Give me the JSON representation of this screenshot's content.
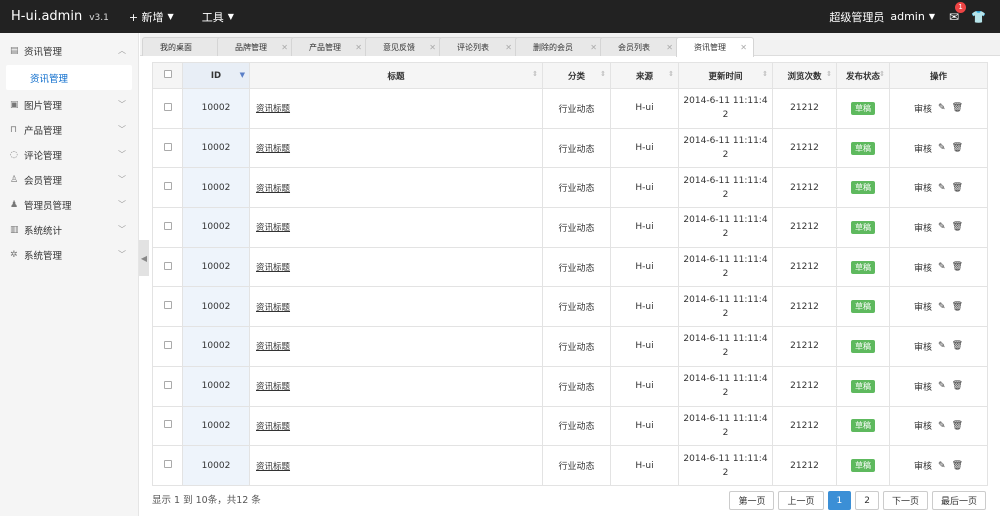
{
  "app": {
    "brand": "H-ui.admin",
    "version": "v3.1"
  },
  "topnav": [
    {
      "label": "+ 新增"
    },
    {
      "label": "工具"
    }
  ],
  "user": {
    "role": "超级管理员",
    "name": "admin",
    "mail_badge": "1"
  },
  "sidebar": {
    "items": [
      {
        "label": "资讯管理",
        "icon": "document-icon"
      },
      {
        "label": "图片管理",
        "icon": "image-icon"
      },
      {
        "label": "产品管理",
        "icon": "bag-icon"
      },
      {
        "label": "评论管理",
        "icon": "comment-icon"
      },
      {
        "label": "会员管理",
        "icon": "user-icon"
      },
      {
        "label": "管理员管理",
        "icon": "admin-icon"
      },
      {
        "label": "系统统计",
        "icon": "stats-icon"
      },
      {
        "label": "系统管理",
        "icon": "gear-icon"
      }
    ],
    "active_sub": "资讯管理"
  },
  "tabs": [
    {
      "label": "我的桌面"
    },
    {
      "label": "品牌管理"
    },
    {
      "label": "产品管理"
    },
    {
      "label": "意见反馈"
    },
    {
      "label": "评论列表"
    },
    {
      "label": "删除的会员"
    },
    {
      "label": "会员列表"
    },
    {
      "label": "资讯管理"
    }
  ],
  "table": {
    "headers": {
      "id": "ID",
      "title": "标题",
      "category": "分类",
      "source": "来源",
      "updated": "更新时间",
      "views": "浏览次数",
      "status": "发布状态",
      "actions": "操作"
    },
    "rows": [
      {
        "id": "10002",
        "title": "资讯标题",
        "category": "行业动态",
        "source": "H-ui",
        "time1": "2014-6-11 11:11:4",
        "time2": "2",
        "views": "21212",
        "status": "草稿",
        "op": "审核"
      },
      {
        "id": "10002",
        "title": "资讯标题",
        "category": "行业动态",
        "source": "H-ui",
        "time1": "2014-6-11 11:11:4",
        "time2": "2",
        "views": "21212",
        "status": "草稿",
        "op": "审核"
      },
      {
        "id": "10002",
        "title": "资讯标题",
        "category": "行业动态",
        "source": "H-ui",
        "time1": "2014-6-11 11:11:4",
        "time2": "2",
        "views": "21212",
        "status": "草稿",
        "op": "审核"
      },
      {
        "id": "10002",
        "title": "资讯标题",
        "category": "行业动态",
        "source": "H-ui",
        "time1": "2014-6-11 11:11:4",
        "time2": "2",
        "views": "21212",
        "status": "草稿",
        "op": "审核"
      },
      {
        "id": "10002",
        "title": "资讯标题",
        "category": "行业动态",
        "source": "H-ui",
        "time1": "2014-6-11 11:11:4",
        "time2": "2",
        "views": "21212",
        "status": "草稿",
        "op": "审核"
      },
      {
        "id": "10002",
        "title": "资讯标题",
        "category": "行业动态",
        "source": "H-ui",
        "time1": "2014-6-11 11:11:4",
        "time2": "2",
        "views": "21212",
        "status": "草稿",
        "op": "审核"
      },
      {
        "id": "10002",
        "title": "资讯标题",
        "category": "行业动态",
        "source": "H-ui",
        "time1": "2014-6-11 11:11:4",
        "time2": "2",
        "views": "21212",
        "status": "草稿",
        "op": "审核"
      },
      {
        "id": "10002",
        "title": "资讯标题",
        "category": "行业动态",
        "source": "H-ui",
        "time1": "2014-6-11 11:11:4",
        "time2": "2",
        "views": "21212",
        "status": "草稿",
        "op": "审核"
      },
      {
        "id": "10002",
        "title": "资讯标题",
        "category": "行业动态",
        "source": "H-ui",
        "time1": "2014-6-11 11:11:4",
        "time2": "2",
        "views": "21212",
        "status": "草稿",
        "op": "审核"
      },
      {
        "id": "10002",
        "title": "资讯标题",
        "category": "行业动态",
        "source": "H-ui",
        "time1": "2014-6-11 11:11:4",
        "time2": "2",
        "views": "21212",
        "status": "草稿",
        "op": "审核"
      }
    ]
  },
  "footer": {
    "info": "显示 1 到 10条，共12 条",
    "pager": {
      "first": "第一页",
      "prev": "上一页",
      "p1": "1",
      "p2": "2",
      "next": "下一页",
      "last": "最后一页"
    }
  },
  "colors": {
    "topbar": "#222222",
    "status_green": "#5eb95e",
    "active_page": "#3b8fd6",
    "link_blue": "#0a6bcc"
  }
}
